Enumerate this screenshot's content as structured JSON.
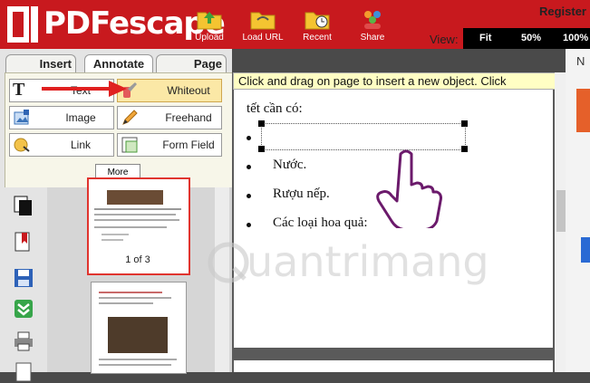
{
  "app": {
    "logo_text": "PDFescape",
    "register_label": "Register"
  },
  "toolbar": {
    "upload": "Upload",
    "load_url": "Load URL",
    "recent": "Recent",
    "share": "Share",
    "view_label": "View:",
    "zoom": [
      "Fit",
      "50%",
      "100%"
    ]
  },
  "tabs": [
    "Insert",
    "Annotate",
    "Page"
  ],
  "tools": {
    "text": "Text",
    "whiteout": "Whiteout",
    "image": "Image",
    "freehand": "Freehand",
    "link": "Link",
    "form_field": "Form Field",
    "more": "More"
  },
  "thumbnail": {
    "page_label": "1 of 3"
  },
  "tooltip": "Click and drag on page to insert a new object. Click",
  "document": {
    "intro": "tết cần có:",
    "items": [
      "Nước.",
      "Rượu nếp.",
      "Các loại hoa quả:"
    ]
  },
  "right_strip_label": "N",
  "watermark": "uantrimang",
  "colors": {
    "brand_red": "#c8191e",
    "selected_tool": "#fbe8a6",
    "annotation_arrow": "#e02020",
    "hand_cursor": "#6b1a6b"
  }
}
